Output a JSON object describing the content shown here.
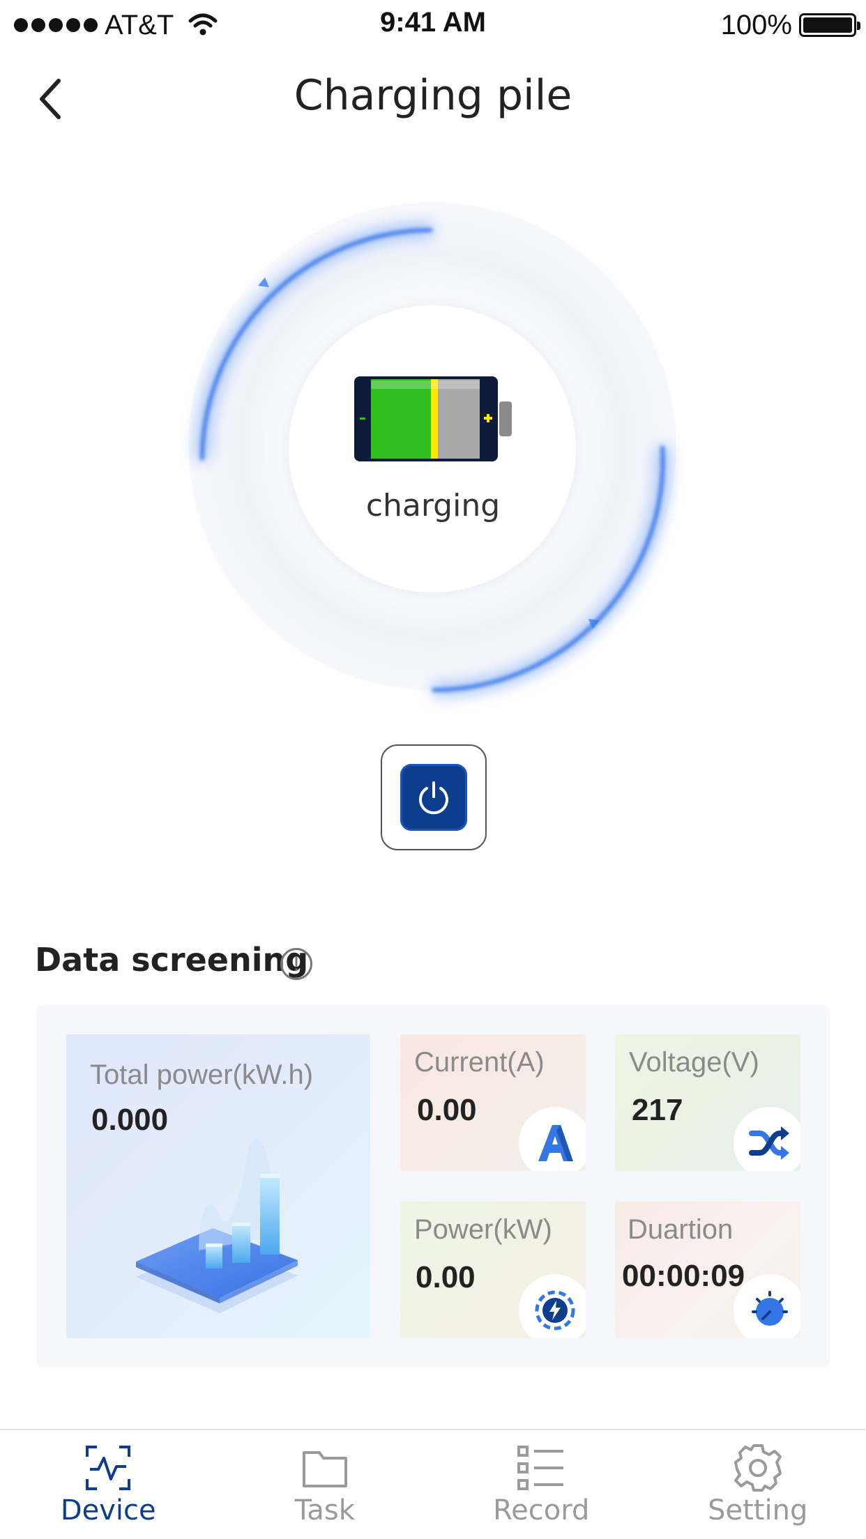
{
  "status_bar": {
    "carrier": "AT&T",
    "time": "9:41 AM",
    "battery": "100%"
  },
  "nav": {
    "title": "Charging pile"
  },
  "charger": {
    "status": "charging",
    "battery_colors": {
      "charge": "#2fbf1f",
      "empty": "#aaaaaa",
      "edge": "#ffe800",
      "casing": "#0d1a3a"
    }
  },
  "power_button": {
    "color": "#0d3e8e",
    "icon": "power-icon"
  },
  "section": {
    "title": "Data screening",
    "info_icon": "!"
  },
  "cards": {
    "total_power": {
      "label": "Total power(kW.h)",
      "value": "0.000",
      "icon": "bar-chart-illustration"
    },
    "current": {
      "label": "Current(A)",
      "value": "0.00",
      "icon": "letter-a-icon"
    },
    "voltage": {
      "label": "Voltage(V)",
      "value": "217",
      "icon": "shuffle-icon"
    },
    "power": {
      "label": "Power(kW)",
      "value": "0.00",
      "icon": "lightning-icon"
    },
    "duration": {
      "label": "Duartion",
      "value": "00:00:09",
      "icon": "timer-icon"
    }
  },
  "tabs": [
    {
      "label": "Device",
      "icon": "device-pulse-icon",
      "active": true
    },
    {
      "label": "Task",
      "icon": "folder-icon",
      "active": false
    },
    {
      "label": "Record",
      "icon": "list-icon",
      "active": false
    },
    {
      "label": "Setting",
      "icon": "gear-icon",
      "active": false
    }
  ],
  "colors": {
    "accent": "#0d3e8e",
    "ring_glow": "#3d7ff0",
    "inactive": "#9a9a9a"
  }
}
